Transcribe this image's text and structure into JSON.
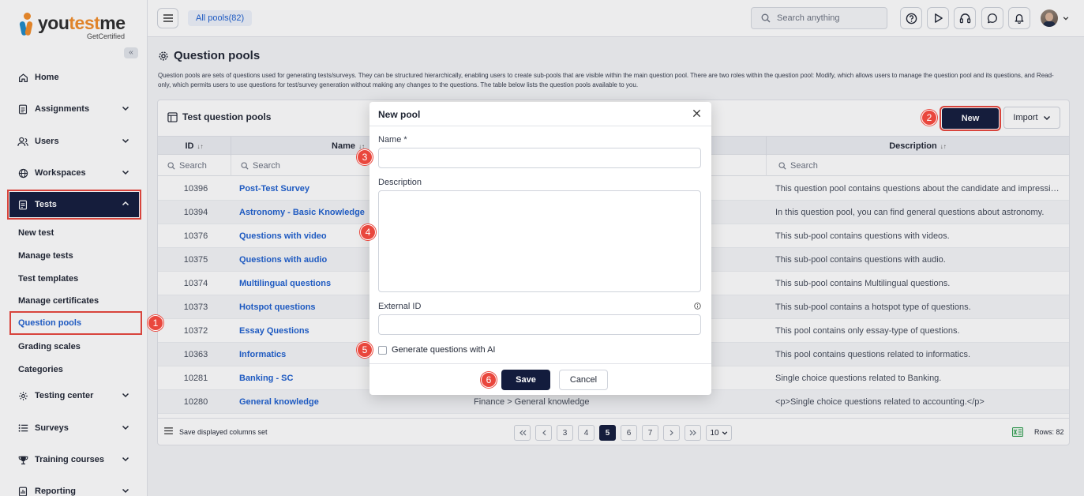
{
  "app": {
    "logo_text_a": "you",
    "logo_text_b": "test",
    "logo_text_c": "me",
    "logo_sub": "GetCertified",
    "collapse_label": "«"
  },
  "colors": {
    "primary_navy": "#131c3d",
    "link_blue": "#1d5fcf",
    "annotation_red": "#e9473d",
    "logo_orange": "#f28c28",
    "logo_blue": "#1d8ac9"
  },
  "sidebar": {
    "items": [
      {
        "label": "Home",
        "icon": "home-icon"
      },
      {
        "label": "Assignments",
        "icon": "clipboard-icon"
      },
      {
        "label": "Users",
        "icon": "users-icon"
      },
      {
        "label": "Workspaces",
        "icon": "globe-icon"
      },
      {
        "label": "Tests",
        "icon": "test-icon"
      },
      {
        "label": "Testing center",
        "icon": "gear-icon"
      },
      {
        "label": "Surveys",
        "icon": "list-icon"
      },
      {
        "label": "Training courses",
        "icon": "trophy-icon"
      },
      {
        "label": "Reporting",
        "icon": "report-icon"
      }
    ],
    "tests_sub": [
      {
        "label": "New test"
      },
      {
        "label": "Manage tests"
      },
      {
        "label": "Test templates"
      },
      {
        "label": "Manage certificates"
      },
      {
        "label": "Question pools"
      },
      {
        "label": "Grading scales"
      },
      {
        "label": "Categories"
      }
    ]
  },
  "topbar": {
    "breadcrumb": "All pools(82)",
    "search_placeholder": "Search anything"
  },
  "page": {
    "title": "Question pools",
    "description": "Question pools are sets of questions used for generating tests/surveys. They can be structured hierarchically, enabling users to create sub-pools that are visible within the main question pool. There are two roles within the question pool: Modify, which allows users to manage the question pool and its questions, and Read-only, which permits users to use questions for test/survey generation without making any changes to the questions. The table below lists the question pools available to you."
  },
  "card": {
    "title": "Test question pools",
    "new_label": "New",
    "import_label": "Import"
  },
  "table": {
    "columns": {
      "id": "ID",
      "name": "Name",
      "description": "Description",
      "sort_glyph": "↓↑"
    },
    "filter_placeholder": "Search",
    "rows": [
      {
        "id": "10396",
        "name": "Post-Test Survey",
        "path": "",
        "description": "This question pool contains questions about the candidate and impressio..."
      },
      {
        "id": "10394",
        "name": "Astronomy - Basic Knowledge",
        "path": "",
        "description": "In this question pool, you can find general questions about astronomy."
      },
      {
        "id": "10376",
        "name": "Questions with video",
        "path": "",
        "description": "This sub-pool contains questions with videos."
      },
      {
        "id": "10375",
        "name": "Questions with audio",
        "path": "",
        "description": "This sub-pool contains questions with audio."
      },
      {
        "id": "10374",
        "name": "Multilingual questions",
        "path": "",
        "description": "This sub-pool contains Multilingual questions."
      },
      {
        "id": "10373",
        "name": "Hotspot questions",
        "path": "",
        "description": "This sub-pool contains a hotspot type of questions."
      },
      {
        "id": "10372",
        "name": "Essay Questions",
        "path": "",
        "description": "This pool contains only essay-type of questions."
      },
      {
        "id": "10363",
        "name": "Informatics",
        "path": "",
        "description": "This pool contains questions related to informatics."
      },
      {
        "id": "10281",
        "name": "Banking - SC",
        "path": "",
        "description": "Single choice questions related to Banking."
      },
      {
        "id": "10280",
        "name": "General knowledge",
        "path": "Finance > General knowledge",
        "description": "<p>Single choice questions related to accounting.</p>"
      }
    ]
  },
  "footer": {
    "save_columns": "Save displayed columns set",
    "pages": [
      "3",
      "4",
      "5",
      "6",
      "7"
    ],
    "current_page": "5",
    "page_size": "10",
    "rows_label": "Rows: 82"
  },
  "modal": {
    "title": "New pool",
    "name_label": "Name *",
    "description_label": "Description",
    "external_id_label": "External ID",
    "ai_checkbox_label": "Generate questions with AI",
    "save_label": "Save",
    "cancel_label": "Cancel"
  },
  "steps": [
    "1",
    "2",
    "3",
    "4",
    "5",
    "6"
  ]
}
